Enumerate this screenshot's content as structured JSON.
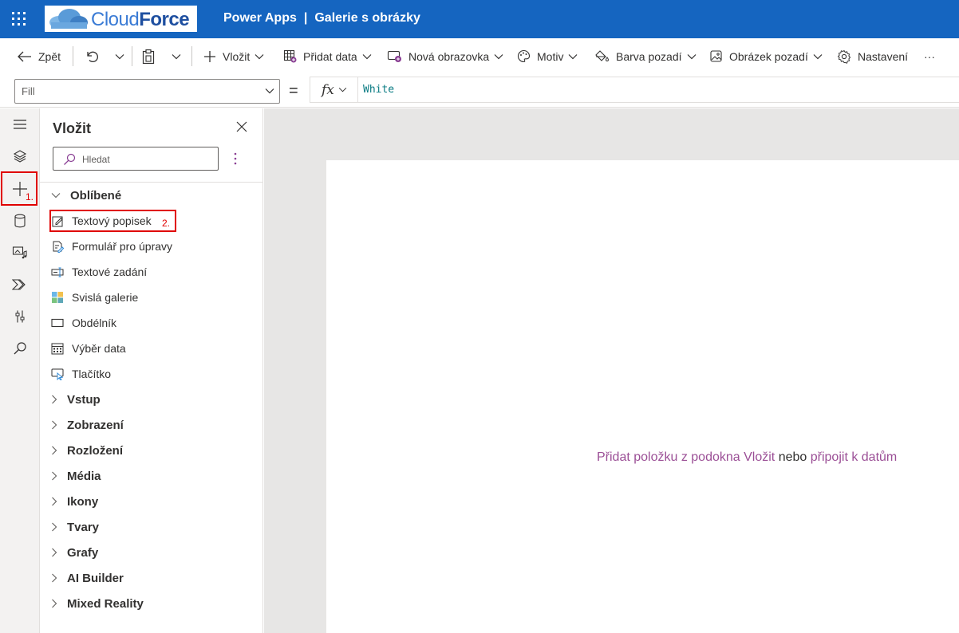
{
  "header": {
    "logo_text_a": "Cloud",
    "logo_text_b": "Force",
    "app_name": "Power Apps",
    "separator": "|",
    "app_title": "Galerie s obrázky"
  },
  "toolbar": {
    "back_label": "Zpět",
    "insert_label": "Vložit",
    "add_data_label": "Přidat data",
    "new_screen_label": "Nová obrazovka",
    "theme_label": "Motiv",
    "bg_color_label": "Barva pozadí",
    "bg_image_label": "Obrázek pozadí",
    "settings_label": "Nastavení",
    "more_label": "···"
  },
  "formula": {
    "property": "Fill",
    "equals": "=",
    "fx": "fx",
    "value": "White"
  },
  "annotations": {
    "step1": "1.",
    "step2": "2."
  },
  "panel": {
    "title": "Vložit",
    "search_placeholder": "Hledat",
    "favorites_label": "Oblíbené",
    "items": [
      {
        "label": "Textový popisek",
        "icon": "text-label-icon"
      },
      {
        "label": "Formulář pro úpravy",
        "icon": "edit-form-icon"
      },
      {
        "label": "Textové zadání",
        "icon": "text-input-icon"
      },
      {
        "label": "Svislá galerie",
        "icon": "gallery-icon"
      },
      {
        "label": "Obdélník",
        "icon": "rectangle-icon"
      },
      {
        "label": "Výběr data",
        "icon": "calendar-icon"
      },
      {
        "label": "Tlačítko",
        "icon": "button-icon"
      }
    ],
    "categories": [
      "Vstup",
      "Zobrazení",
      "Rozložení",
      "Média",
      "Ikony",
      "Tvary",
      "Grafy",
      "AI Builder",
      "Mixed Reality"
    ]
  },
  "canvas": {
    "hint_link1": "Přidat položku z podokna Vložit",
    "hint_middle": "nebo",
    "hint_link2": "připojit k datům"
  },
  "colors": {
    "header_bg": "#1565c0",
    "accent_purple": "#9b4f96",
    "annotation_red": "#e00000",
    "canvas_bg": "#e7e6e5"
  }
}
